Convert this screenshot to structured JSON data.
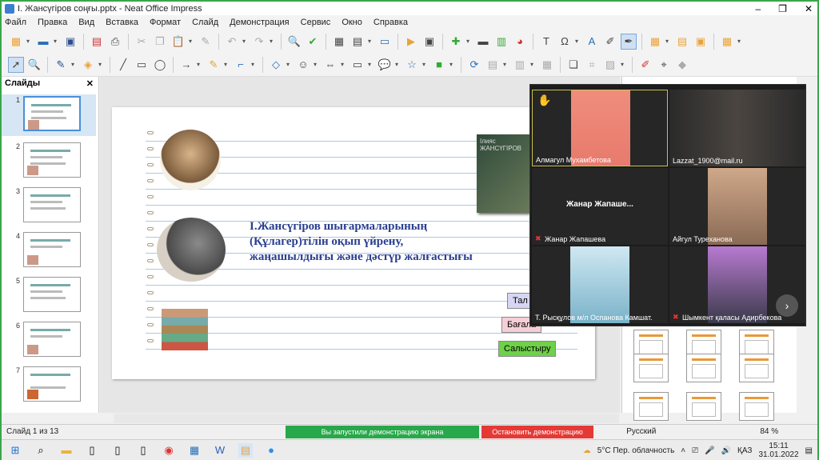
{
  "window": {
    "title": "I. Жансүгіров соңғы.pptx - Neat Office Impress",
    "controls": [
      "–",
      "❐",
      "✕"
    ]
  },
  "menu": [
    "Файл",
    "Правка",
    "Вид",
    "Вставка",
    "Формат",
    "Слайд",
    "Демонстрация",
    "Сервис",
    "Окно",
    "Справка"
  ],
  "panel": {
    "title": "Слайды",
    "close": "✕",
    "slides": [
      "1",
      "2",
      "3",
      "4",
      "5",
      "6",
      "7"
    ]
  },
  "slide": {
    "title": "І.Жансүгіров шығармаларының (Құлагер)тілін оқып үйрену, жаңашылдығы және дәстүр жалғастығы",
    "book_text": "Ілияс ЖАНСҮГІРОВ",
    "buttons": {
      "talda": "Тал",
      "bagala": "Бағала",
      "salystyru": "Салыстыру"
    }
  },
  "video": {
    "participants": [
      {
        "name": "Алмагул Мухамбетова",
        "hand": "✋"
      },
      {
        "name": "Lazzat_1900@mail.ru"
      },
      {
        "name": "Жанар Жапашева",
        "center": "Жанар  Жапаше..."
      },
      {
        "name": "Айгул Туреханова"
      },
      {
        "name": "Т. Рысқұлов м/л Оспанова Камшат."
      },
      {
        "name": "Шымкент қаласы Адирбекова"
      }
    ],
    "next": "›"
  },
  "status": {
    "slide": "Слайд 1 из 13",
    "lang": "Русский",
    "zoom": "84 %"
  },
  "demo": {
    "running": "Вы запустили демонстрацию экрана",
    "stop": "Остановить демонстрацию"
  },
  "tray": {
    "weather": "5°C  Пер. облачность",
    "lang": "ҚАЗ",
    "time": "15:11",
    "date": "31.01.2022"
  }
}
